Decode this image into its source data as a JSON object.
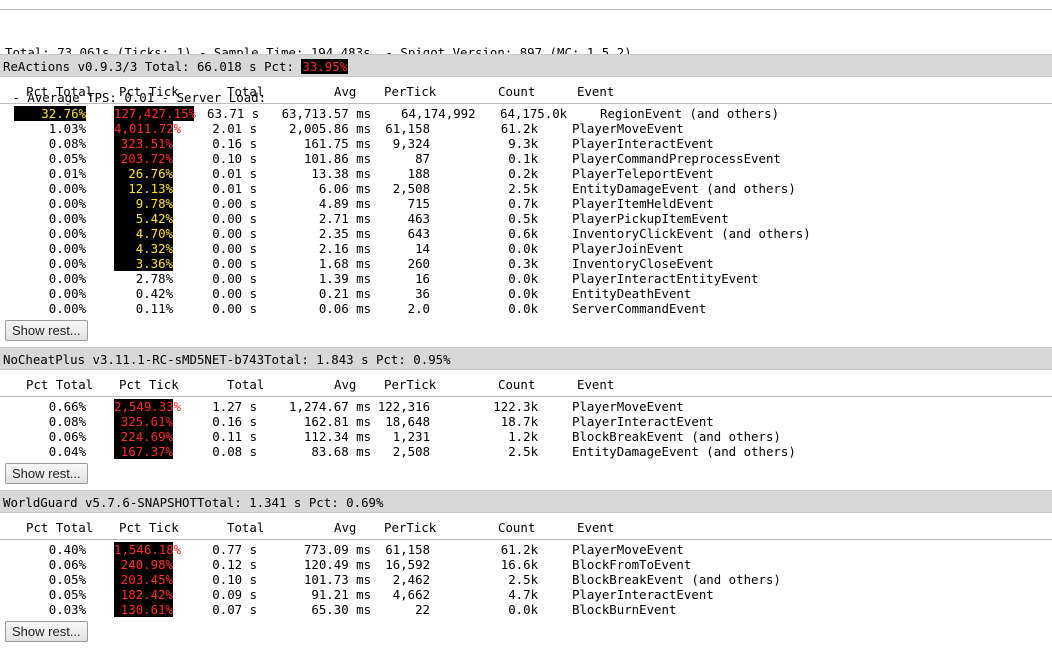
{
  "summary": {
    "line1": "Total: 73.061s (Ticks: 1) - Sample Time: 194.483s  - Spigot Version: 897 (MC: 1.5.2)",
    "line2": " - Average TPS: 0.01 - Server Load:"
  },
  "columns": {
    "pct_total": "Pct Total",
    "pct_tick": "Pct Tick",
    "total": "Total",
    "avg": "Avg",
    "per_tick": "PerTick",
    "count": "Count",
    "event": "Event"
  },
  "show_rest_label": "Show rest...",
  "plugins": [
    {
      "name_total": "ReActions v0.9.3/3 Total: 66.018 s Pct: ",
      "pct": "33.95%",
      "rows": [
        {
          "pct_total": "32.76%",
          "pct_tick": "127,427.15%",
          "total": "63.71 s",
          "avg": "63,713.57 ms",
          "per_tick": "64,174,992",
          "count": "64,175.0k",
          "event": "RegionEvent (and others)"
        },
        {
          "pct_total": "1.03%",
          "pct_tick": "4,011.72%",
          "total": "2.01 s",
          "avg": "2,005.86 ms",
          "per_tick": "61,158",
          "count": "61.2k",
          "event": "PlayerMoveEvent"
        },
        {
          "pct_total": "0.08%",
          "pct_tick": "323.51%",
          "total": "0.16 s",
          "avg": "161.75 ms",
          "per_tick": "9,324",
          "count": "9.3k",
          "event": "PlayerInteractEvent"
        },
        {
          "pct_total": "0.05%",
          "pct_tick": "203.72%",
          "total": "0.10 s",
          "avg": "101.86 ms",
          "per_tick": "87",
          "count": "0.1k",
          "event": "PlayerCommandPreprocessEvent"
        },
        {
          "pct_total": "0.01%",
          "pct_tick": "26.76%",
          "total": "0.01 s",
          "avg": "13.38 ms",
          "per_tick": "188",
          "count": "0.2k",
          "event": "PlayerTeleportEvent"
        },
        {
          "pct_total": "0.00%",
          "pct_tick": "12.13%",
          "total": "0.01 s",
          "avg": "6.06 ms",
          "per_tick": "2,508",
          "count": "2.5k",
          "event": "EntityDamageEvent (and others)"
        },
        {
          "pct_total": "0.00%",
          "pct_tick": "9.78%",
          "total": "0.00 s",
          "avg": "4.89 ms",
          "per_tick": "715",
          "count": "0.7k",
          "event": "PlayerItemHeldEvent"
        },
        {
          "pct_total": "0.00%",
          "pct_tick": "5.42%",
          "total": "0.00 s",
          "avg": "2.71 ms",
          "per_tick": "463",
          "count": "0.5k",
          "event": "PlayerPickupItemEvent"
        },
        {
          "pct_total": "0.00%",
          "pct_tick": "4.70%",
          "total": "0.00 s",
          "avg": "2.35 ms",
          "per_tick": "643",
          "count": "0.6k",
          "event": "InventoryClickEvent (and others)"
        },
        {
          "pct_total": "0.00%",
          "pct_tick": "4.32%",
          "total": "0.00 s",
          "avg": "2.16 ms",
          "per_tick": "14",
          "count": "0.0k",
          "event": "PlayerJoinEvent"
        },
        {
          "pct_total": "0.00%",
          "pct_tick": "3.36%",
          "total": "0.00 s",
          "avg": "1.68 ms",
          "per_tick": "260",
          "count": "0.3k",
          "event": "InventoryCloseEvent"
        },
        {
          "pct_total": "0.00%",
          "pct_tick": "2.78%",
          "total": "0.00 s",
          "avg": "1.39 ms",
          "per_tick": "16",
          "count": "0.0k",
          "event": "PlayerInteractEntityEvent"
        },
        {
          "pct_total": "0.00%",
          "pct_tick": "0.42%",
          "total": "0.00 s",
          "avg": "0.21 ms",
          "per_tick": "36",
          "count": "0.0k",
          "event": "EntityDeathEvent"
        },
        {
          "pct_total": "0.00%",
          "pct_tick": "0.11%",
          "total": "0.00 s",
          "avg": "0.06 ms",
          "per_tick": "2.0",
          "count": "0.0k",
          "event": "ServerCommandEvent"
        }
      ]
    },
    {
      "name_total": "NoCheatPlus v3.11.1-RC-sMD5NET-b743Total: 1.843 s Pct: 0.95%",
      "pct": "",
      "rows": [
        {
          "pct_total": "0.66%",
          "pct_tick": "2,549.33%",
          "total": "1.27 s",
          "avg": "1,274.67 ms",
          "per_tick": "122,316",
          "count": "122.3k",
          "event": "PlayerMoveEvent"
        },
        {
          "pct_total": "0.08%",
          "pct_tick": "325.61%",
          "total": "0.16 s",
          "avg": "162.81 ms",
          "per_tick": "18,648",
          "count": "18.7k",
          "event": "PlayerInteractEvent"
        },
        {
          "pct_total": "0.06%",
          "pct_tick": "224.69%",
          "total": "0.11 s",
          "avg": "112.34 ms",
          "per_tick": "1,231",
          "count": "1.2k",
          "event": "BlockBreakEvent (and others)"
        },
        {
          "pct_total": "0.04%",
          "pct_tick": "167.37%",
          "total": "0.08 s",
          "avg": "83.68 ms",
          "per_tick": "2,508",
          "count": "2.5k",
          "event": "EntityDamageEvent (and others)"
        }
      ]
    },
    {
      "name_total": "WorldGuard v5.7.6-SNAPSHOTTotal: 1.341 s Pct: 0.69%",
      "pct": "",
      "rows": [
        {
          "pct_total": "0.40%",
          "pct_tick": "1,546.18%",
          "total": "0.77 s",
          "avg": "773.09 ms",
          "per_tick": "61,158",
          "count": "61.2k",
          "event": "PlayerMoveEvent"
        },
        {
          "pct_total": "0.06%",
          "pct_tick": "240.98%",
          "total": "0.12 s",
          "avg": "120.49 ms",
          "per_tick": "16,592",
          "count": "16.6k",
          "event": "BlockFromToEvent"
        },
        {
          "pct_total": "0.05%",
          "pct_tick": "203.45%",
          "total": "0.10 s",
          "avg": "101.73 ms",
          "per_tick": "2,462",
          "count": "2.5k",
          "event": "BlockBreakEvent (and others)"
        },
        {
          "pct_total": "0.05%",
          "pct_tick": "182.42%",
          "total": "0.09 s",
          "avg": "91.21 ms",
          "per_tick": "4,662",
          "count": "4.7k",
          "event": "PlayerInteractEvent"
        },
        {
          "pct_total": "0.03%",
          "pct_tick": "130.61%",
          "total": "0.07 s",
          "avg": "65.30 ms",
          "per_tick": "22",
          "count": "0.0k",
          "event": "BlockBurnEvent"
        }
      ]
    }
  ]
}
